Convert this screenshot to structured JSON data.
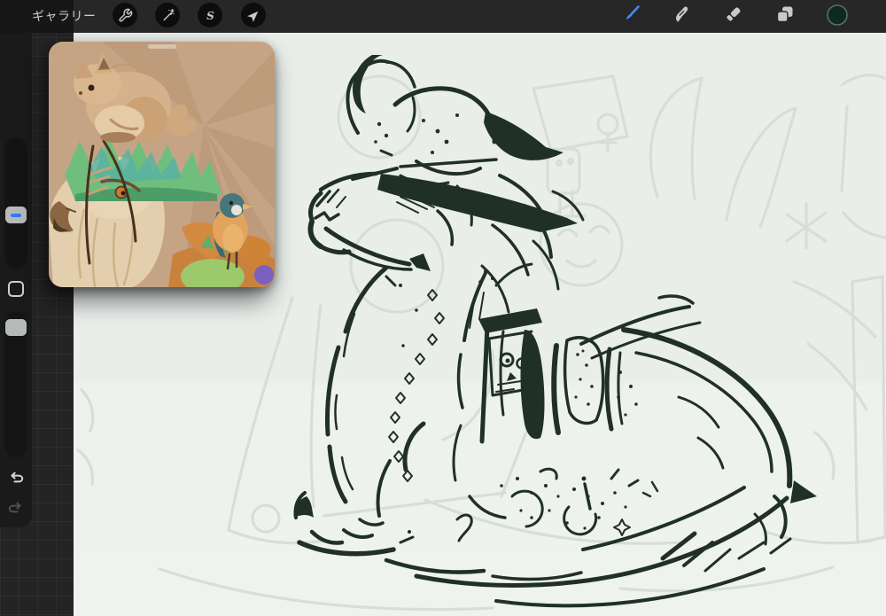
{
  "top_bar": {
    "gallery_label": "ギャラリー",
    "left_tools": [
      {
        "name": "actions",
        "icon": "wrench-icon"
      },
      {
        "name": "adjustments",
        "icon": "magic-wand-icon"
      },
      {
        "name": "selection",
        "icon": "s-curve-icon",
        "glyph": "S"
      },
      {
        "name": "transform",
        "icon": "arrow-cursor-icon"
      }
    ],
    "right_tools": [
      {
        "name": "paint",
        "icon": "brush-icon",
        "active": true,
        "active_color": "#3f8cff"
      },
      {
        "name": "smudge",
        "icon": "smudge-finger-icon"
      },
      {
        "name": "erase",
        "icon": "eraser-icon"
      },
      {
        "name": "layers",
        "icon": "layers-icon"
      },
      {
        "name": "color",
        "icon": "color-swatch-circle",
        "swatch_color": "#0e2a1f",
        "ring_color": "#5d6f66"
      }
    ]
  },
  "sidebar": {
    "brush_size_slider": {
      "indicator_color": "#3478f6"
    },
    "modify_button": {
      "icon": "square-outline-icon"
    },
    "opacity_slider": {},
    "undo": {
      "icon": "undo-arrow-icon",
      "enabled": true
    },
    "redo": {
      "icon": "redo-arrow-icon",
      "enabled": false
    }
  },
  "reference_panel": {
    "subject": "figurine photo: feathered bird-dragon with squirrel on head and small bird on back",
    "has_drag_handle": true
  },
  "canvas": {
    "background_color": "#edf1ee",
    "ink_color": "#203029",
    "ghost_sketch_color": "#d7ded8",
    "subject": "black ink sketch of a seated feathered dragon with helmet crest, saddle bags and sweeping tail over faint construction sketches"
  },
  "colors": {
    "top_bar": "#272727",
    "gallery_zone": "#161616",
    "app_background": "#242424",
    "sidebar": "#1a1a1a"
  }
}
